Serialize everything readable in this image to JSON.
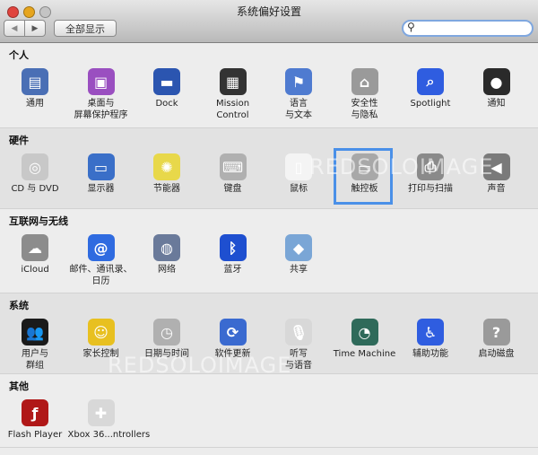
{
  "window": {
    "title": "系统偏好设置",
    "show_all": "全部显示",
    "back": "◀",
    "forward": "▶",
    "search_placeholder": "",
    "search_icon": "magnifier-icon"
  },
  "colors": {
    "selection": "#4a90e8",
    "close": "#e0443e",
    "minimize": "#e6a51e",
    "zoom": "#b8b8b8"
  },
  "sections": [
    {
      "title": "个人",
      "items": [
        {
          "label": "通用",
          "icon": "general-icon",
          "color": "#4a6fb5",
          "glyph": "▤"
        },
        {
          "label": "桌面与\n屏幕保护程序",
          "icon": "desktop-icon",
          "color": "#9a4fc0",
          "glyph": "▣"
        },
        {
          "label": "Dock",
          "icon": "dock-icon",
          "color": "#2b55b0",
          "glyph": "▬"
        },
        {
          "label": "Mission\nControl",
          "icon": "mission-control-icon",
          "color": "#333333",
          "glyph": "▦"
        },
        {
          "label": "语言\n与文本",
          "icon": "language-flag-icon",
          "color": "#4f7bd0",
          "glyph": "⚑"
        },
        {
          "label": "安全性\n与隐私",
          "icon": "security-house-icon",
          "color": "#9a9a9a",
          "glyph": "⌂"
        },
        {
          "label": "Spotlight",
          "icon": "spotlight-icon",
          "color": "#2f5de0",
          "glyph": "⌕"
        },
        {
          "label": "通知",
          "icon": "notifications-icon",
          "color": "#2a2a2a",
          "glyph": "●"
        }
      ]
    },
    {
      "title": "硬件",
      "items": [
        {
          "label": "CD 与 DVD",
          "icon": "cd-dvd-icon",
          "color": "#c8c8c8",
          "glyph": "◎"
        },
        {
          "label": "显示器",
          "icon": "display-icon",
          "color": "#3a6fc8",
          "glyph": "▭"
        },
        {
          "label": "节能器",
          "icon": "energy-bulb-icon",
          "color": "#e8d84a",
          "glyph": "✺"
        },
        {
          "label": "键盘",
          "icon": "keyboard-icon",
          "color": "#b0b0b0",
          "glyph": "⌨"
        },
        {
          "label": "鼠标",
          "icon": "mouse-icon",
          "color": "#f4f4f4",
          "glyph": "▯"
        },
        {
          "label": "触控板",
          "icon": "trackpad-icon",
          "color": "#a8a8a8",
          "glyph": "▭",
          "selected": true
        },
        {
          "label": "打印与扫描",
          "icon": "printer-icon",
          "color": "#8a8a8a",
          "glyph": "⎙"
        },
        {
          "label": "声音",
          "icon": "speaker-icon",
          "color": "#7a7a7a",
          "glyph": "◀"
        }
      ]
    },
    {
      "title": "互联网与无线",
      "items": [
        {
          "label": "iCloud",
          "icon": "icloud-icon",
          "color": "#8c8c8c",
          "glyph": "☁"
        },
        {
          "label": "邮件、通讯录、\n日历",
          "icon": "mail-at-icon",
          "color": "#2f6be0",
          "glyph": "@"
        },
        {
          "label": "网络",
          "icon": "network-globe-icon",
          "color": "#6a7a9a",
          "glyph": "◍"
        },
        {
          "label": "蓝牙",
          "icon": "bluetooth-icon",
          "color": "#1e4fd0",
          "glyph": "ᛒ"
        },
        {
          "label": "共享",
          "icon": "sharing-folder-icon",
          "color": "#7aa6d6",
          "glyph": "◆"
        }
      ]
    },
    {
      "title": "系统",
      "items": [
        {
          "label": "用户与\n群组",
          "icon": "users-icon",
          "color": "#1a1a1a",
          "glyph": "👥"
        },
        {
          "label": "家长控制",
          "icon": "parental-controls-icon",
          "color": "#e8c020",
          "glyph": "☺"
        },
        {
          "label": "日期与时间",
          "icon": "clock-calendar-icon",
          "color": "#b0b0b0",
          "glyph": "◷"
        },
        {
          "label": "软件更新",
          "icon": "software-update-icon",
          "color": "#3a6ad0",
          "glyph": "⟳"
        },
        {
          "label": "听写\n与语音",
          "icon": "microphone-icon",
          "color": "#d8d8d8",
          "glyph": "🎙"
        },
        {
          "label": "Time Machine",
          "icon": "time-machine-icon",
          "color": "#2f6a5a",
          "glyph": "◔"
        },
        {
          "label": "辅助功能",
          "icon": "accessibility-icon",
          "color": "#2f5de0",
          "glyph": "♿"
        },
        {
          "label": "启动磁盘",
          "icon": "startup-disk-icon",
          "color": "#9a9a9a",
          "glyph": "?"
        }
      ]
    },
    {
      "title": "其他",
      "items": [
        {
          "label": "Flash Player",
          "icon": "flash-player-icon",
          "color": "#b01818",
          "glyph": "ƒ"
        },
        {
          "label": "Xbox 36...ntrollers",
          "icon": "xbox-controller-icon",
          "color": "#d8d8d8",
          "glyph": "✚"
        }
      ]
    }
  ],
  "watermark": {
    "text1": "REDSOLOIMAGE",
    "text2": "REDSOLOIMAGE"
  }
}
